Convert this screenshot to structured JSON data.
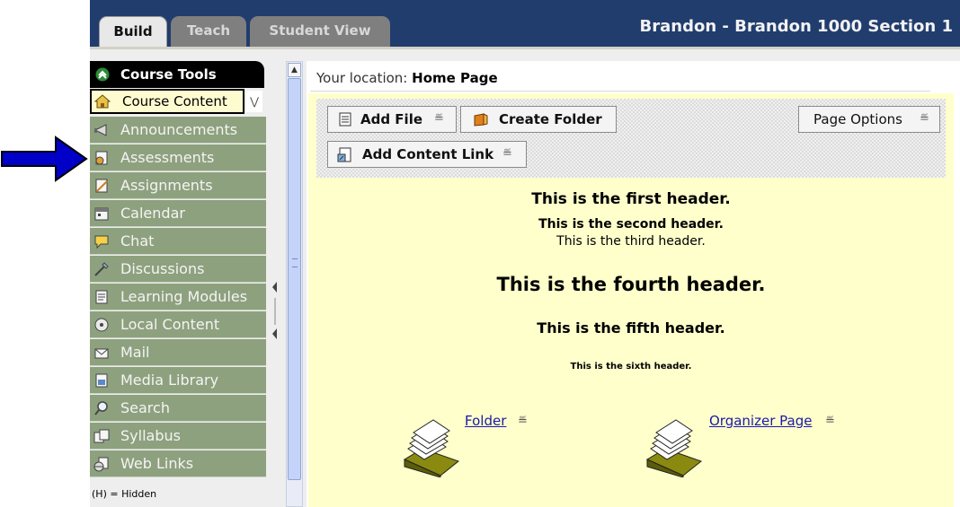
{
  "header": {
    "tabs": [
      {
        "label": "Build",
        "active": true
      },
      {
        "label": "Teach",
        "active": false
      },
      {
        "label": "Student View",
        "active": false
      }
    ],
    "course_title": "Brandon - Brandon 1000 Section 1"
  },
  "sidebar": {
    "header": "Course Tools",
    "selected": {
      "label": "Course Content",
      "icon": "home-icon"
    },
    "items": [
      {
        "label": "Announcements",
        "icon": "megaphone-icon"
      },
      {
        "label": "Assessments",
        "icon": "assessment-icon"
      },
      {
        "label": "Assignments",
        "icon": "assignment-icon"
      },
      {
        "label": "Calendar",
        "icon": "calendar-icon"
      },
      {
        "label": "Chat",
        "icon": "chat-icon"
      },
      {
        "label": "Discussions",
        "icon": "discussion-icon"
      },
      {
        "label": "Learning Modules",
        "icon": "module-icon"
      },
      {
        "label": "Local Content",
        "icon": "disc-icon"
      },
      {
        "label": "Mail",
        "icon": "mail-icon"
      },
      {
        "label": "Media Library",
        "icon": "media-icon"
      },
      {
        "label": "Search",
        "icon": "search-icon"
      },
      {
        "label": "Syllabus",
        "icon": "syllabus-icon"
      },
      {
        "label": "Web Links",
        "icon": "weblinks-icon"
      }
    ],
    "hidden_note": "(H) = Hidden"
  },
  "location": {
    "prefix": "Your location:",
    "page": "Home Page"
  },
  "toolbar": {
    "add_file": "Add File",
    "create_folder": "Create Folder",
    "page_options": "Page Options",
    "add_content_link": "Add Content Link"
  },
  "headers": {
    "h1": "This is the first header.",
    "h2": "This is the second header.",
    "h3": "This is the third header.",
    "h4": "This is the fourth header.",
    "h5": "This is the fifth header.",
    "h6": "This is the sixth header."
  },
  "items": [
    {
      "label": "Folder",
      "icon": "folder-stack-icon"
    },
    {
      "label": "Organizer Page",
      "icon": "folder-stack-icon"
    }
  ],
  "colors": {
    "header_bg": "#213d6e",
    "sidebar_item_bg": "#8ea17e",
    "content_bg": "#ffffcc",
    "link": "#1a1aa6",
    "arrow": "#0000c8"
  }
}
